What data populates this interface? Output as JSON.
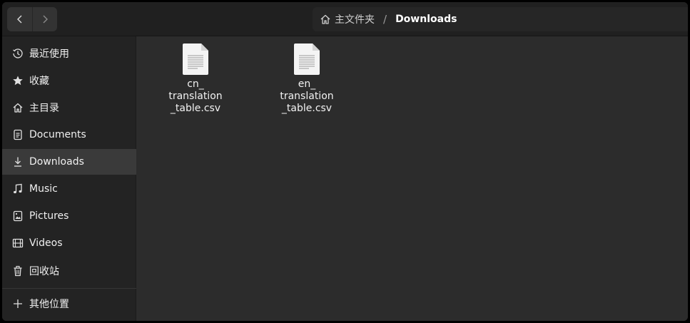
{
  "header": {
    "back_icon": "chevron-left-icon",
    "forward_icon": "chevron-right-icon",
    "breadcrumb": {
      "home_icon": "home-icon",
      "home_label": "主文件夹",
      "separator": "/",
      "current_label": "Downloads"
    }
  },
  "sidebar": {
    "items": [
      {
        "label": "最近使用",
        "icon": "clock-icon"
      },
      {
        "label": "收藏",
        "icon": "star-icon"
      },
      {
        "label": "主目录",
        "icon": "home-icon"
      },
      {
        "label": "Documents",
        "icon": "document-icon"
      },
      {
        "label": "Downloads",
        "icon": "download-icon",
        "active": true
      },
      {
        "label": "Music",
        "icon": "music-note-icon"
      },
      {
        "label": "Pictures",
        "icon": "picture-icon"
      },
      {
        "label": "Videos",
        "icon": "film-icon"
      },
      {
        "label": "回收站",
        "icon": "trash-icon"
      },
      {
        "label": "其他位置",
        "icon": "plus-icon"
      }
    ]
  },
  "files": [
    {
      "name": "cn_\ntranslation\n_table.csv",
      "icon": "text-file-icon"
    },
    {
      "name": "en_\ntranslation\n_table.csv",
      "icon": "text-file-icon"
    }
  ],
  "colors": {
    "window_bg": "#2c2c2c",
    "sidebar_bg": "#232323",
    "header_bg": "#202020",
    "active_item_bg": "#3a3a3a",
    "text": "#f0f0f0"
  }
}
